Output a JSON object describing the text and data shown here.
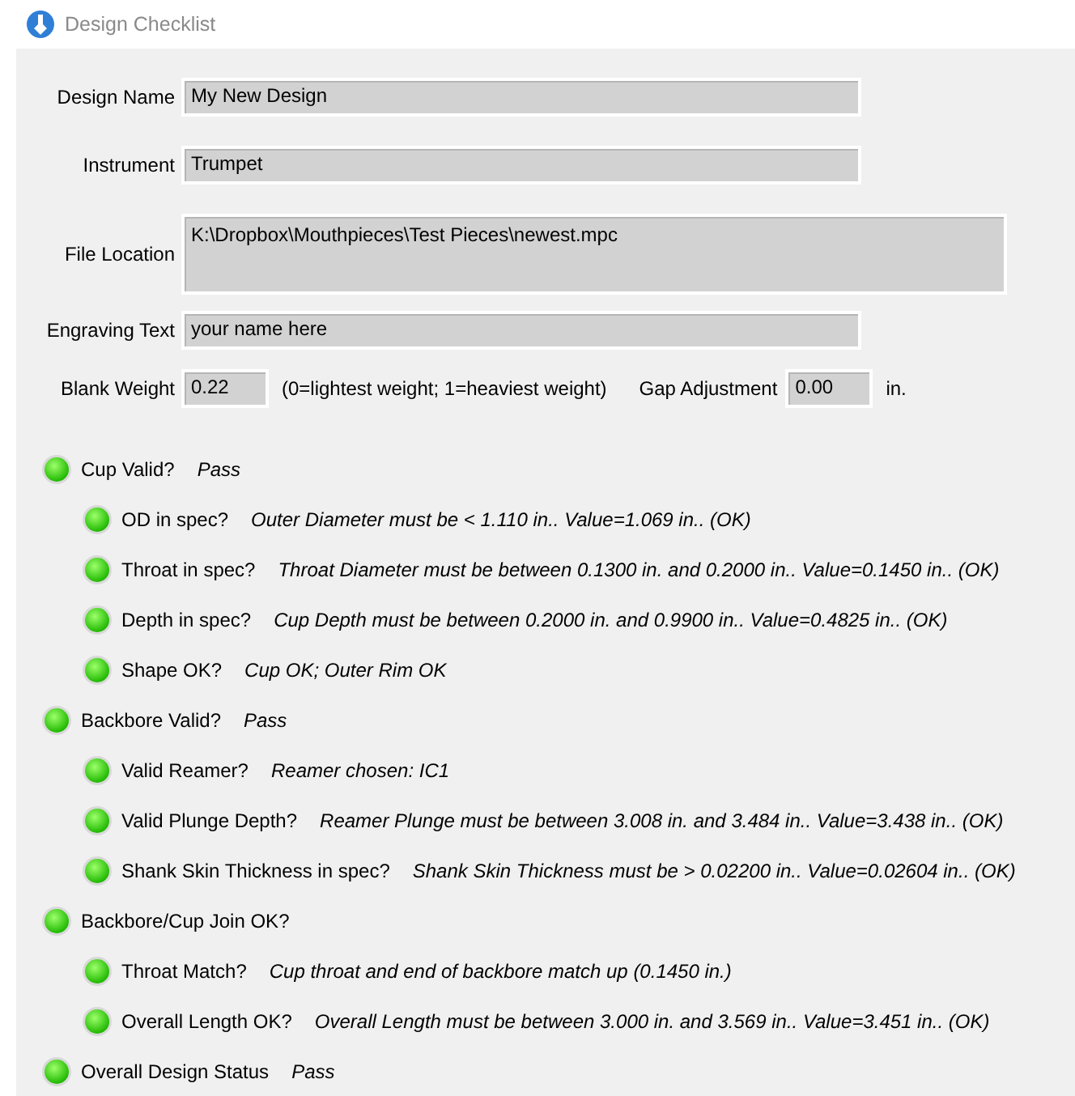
{
  "window": {
    "title": "Design Checklist"
  },
  "fields": [
    {
      "label": "Design Name",
      "value": "My New Design",
      "kind": "line"
    },
    {
      "label": "Instrument",
      "value": "Trumpet",
      "kind": "line"
    },
    {
      "label": "File Location",
      "value": "K:\\Dropbox\\Mouthpieces\\Test Pieces\\newest.mpc",
      "kind": "area"
    },
    {
      "label": "Engraving Text",
      "value": "your name here",
      "kind": "line"
    }
  ],
  "blank_weight": {
    "label": "Blank Weight",
    "value": "0.22",
    "note": "(0=lightest weight; 1=heaviest weight)"
  },
  "gap_adjustment": {
    "label": "Gap Adjustment",
    "value": "0.00",
    "unit": "in."
  },
  "checks": [
    {
      "label": "Cup Valid?",
      "detail": "Pass",
      "ok": true,
      "children": [
        {
          "label": "OD in spec?",
          "detail": "Outer Diameter must be < 1.110 in.. Value=1.069 in.. (OK)",
          "ok": true
        },
        {
          "label": "Throat in spec?",
          "detail": "Throat Diameter must be between 0.1300 in. and 0.2000 in.. Value=0.1450 in.. (OK)",
          "ok": true
        },
        {
          "label": "Depth in spec?",
          "detail": "Cup Depth must be between 0.2000 in. and 0.9900 in.. Value=0.4825 in.. (OK)",
          "ok": true
        },
        {
          "label": "Shape OK?",
          "detail": "Cup OK; Outer Rim OK",
          "ok": true
        }
      ]
    },
    {
      "label": "Backbore Valid?",
      "detail": "Pass",
      "ok": true,
      "children": [
        {
          "label": "Valid Reamer?",
          "detail": "Reamer chosen: IC1",
          "ok": true
        },
        {
          "label": "Valid Plunge Depth?",
          "detail": "Reamer Plunge must be between 3.008 in. and 3.484 in.. Value=3.438 in.. (OK)",
          "ok": true
        },
        {
          "label": "Shank Skin Thickness in spec?",
          "detail": "Shank Skin Thickness must be > 0.02200 in.. Value=0.02604 in.. (OK)",
          "ok": true
        }
      ]
    },
    {
      "label": "Backbore/Cup Join OK?",
      "ok": true,
      "children": [
        {
          "label": "Throat Match?",
          "detail": "Cup throat and end of backbore match up (0.1450 in.)",
          "ok": true
        },
        {
          "label": "Overall Length OK?",
          "detail": "Overall Length must be between 3.000 in. and 3.569 in.. Value=3.451 in.. (OK)",
          "ok": true
        }
      ]
    },
    {
      "label": "Overall Design Status",
      "detail": "Pass",
      "ok": true
    }
  ]
}
